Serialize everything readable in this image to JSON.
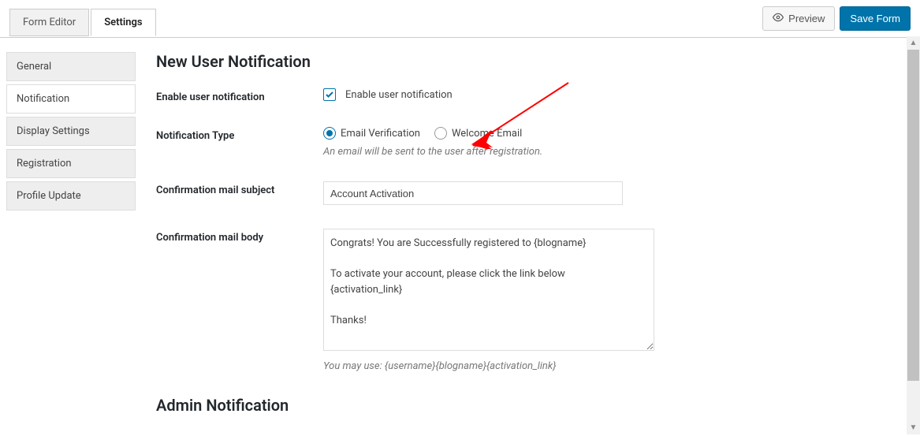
{
  "tabs": {
    "editor": "Form Editor",
    "settings": "Settings"
  },
  "actions": {
    "preview": "Preview",
    "save": "Save Form"
  },
  "sidebar": {
    "items": [
      {
        "label": "General"
      },
      {
        "label": "Notification"
      },
      {
        "label": "Display Settings"
      },
      {
        "label": "Registration"
      },
      {
        "label": "Profile Update"
      }
    ]
  },
  "page": {
    "heading": "New User Notification",
    "enable_label": "Enable user notification",
    "enable_checkbox_label": "Enable user notification",
    "type_label": "Notification Type",
    "radio_email": "Email Verification",
    "radio_welcome": "Welcome Email",
    "type_hint": "An email will be sent to the user after registration.",
    "subject_label": "Confirmation mail subject",
    "subject_value": "Account Activation",
    "body_label": "Confirmation mail body",
    "body_value": "Congrats! You are Successfully registered to {blogname}\n\nTo activate your account, please click the link below\n{activation_link}\n\nThanks!",
    "body_hint": "You may use: {username}{blogname}{activation_link}",
    "admin_heading": "Admin Notification"
  }
}
